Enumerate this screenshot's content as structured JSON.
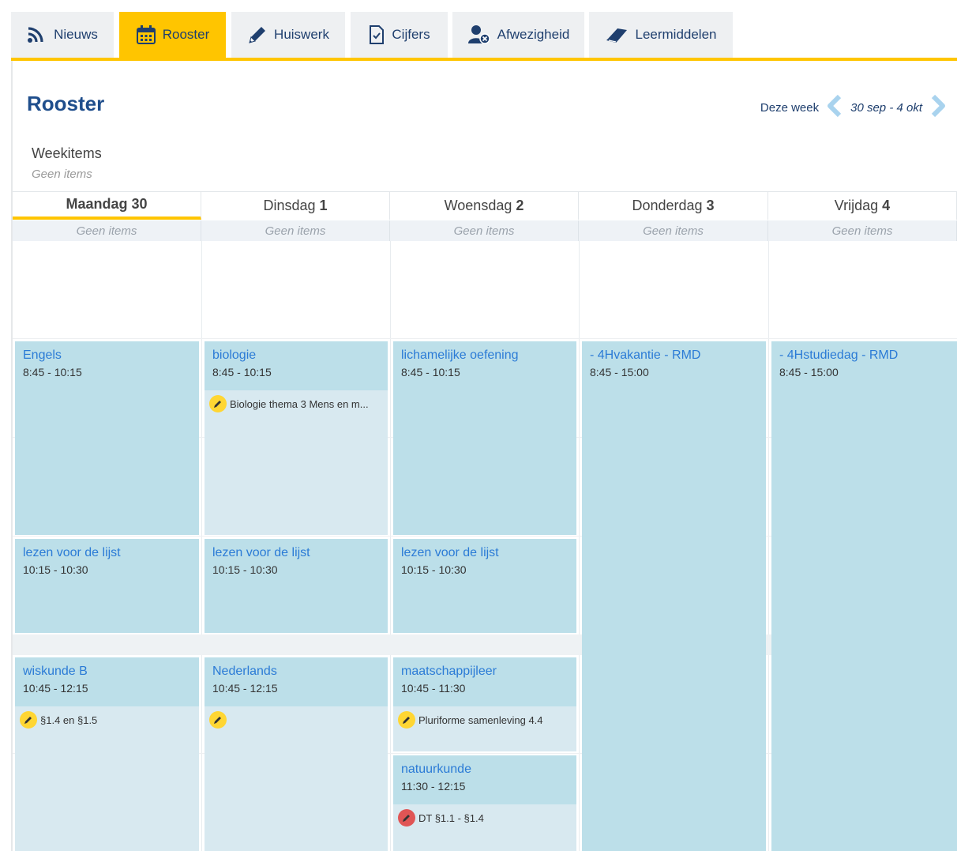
{
  "tabs": [
    {
      "label": "Nieuws",
      "icon": "rss-icon"
    },
    {
      "label": "Rooster",
      "icon": "calendar-icon"
    },
    {
      "label": "Huiswerk",
      "icon": "pencil-icon"
    },
    {
      "label": "Cijfers",
      "icon": "check-document-icon"
    },
    {
      "label": "Afwezigheid",
      "icon": "user-absent-icon"
    },
    {
      "label": "Leermiddelen",
      "icon": "book-icon"
    }
  ],
  "active_tab": "Rooster",
  "page": {
    "title": "Rooster",
    "week_label": "Deze week",
    "week_range": "30 sep - 4 okt",
    "weekitems_label": "Weekitems",
    "weekitems_empty": "Geen items"
  },
  "days": [
    {
      "name": "Maandag",
      "num": "30",
      "empty": "Geen items"
    },
    {
      "name": "Dinsdag",
      "num": "1",
      "empty": "Geen items"
    },
    {
      "name": "Woensdag",
      "num": "2",
      "empty": "Geen items"
    },
    {
      "name": "Donderdag",
      "num": "3",
      "empty": "Geen items"
    },
    {
      "name": "Vrijdag",
      "num": "4",
      "empty": "Geen items"
    }
  ],
  "lessons": {
    "mon": [
      {
        "subject": "Engels",
        "time": "8:45 - 10:15"
      },
      {
        "subject": "lezen voor de lijst",
        "time": "10:15 - 10:30"
      },
      {
        "subject": "wiskunde B",
        "time": "10:45 - 12:15",
        "homework": "§1.4 en §1.5"
      }
    ],
    "tue": [
      {
        "subject": "biologie",
        "time": "8:45 - 10:15",
        "homework": "Biologie thema 3 Mens en m..."
      },
      {
        "subject": "lezen voor de lijst",
        "time": "10:15 - 10:30"
      },
      {
        "subject": "Nederlands",
        "time": "10:45 - 12:15",
        "homework": ""
      }
    ],
    "wed": [
      {
        "subject": "lichamelijke oefening",
        "time": "8:45 - 10:15"
      },
      {
        "subject": "lezen voor de lijst",
        "time": "10:15 - 10:30"
      },
      {
        "subject": "maatschappijleer",
        "time": "10:45 - 11:30",
        "homework": "Pluriforme samenleving 4.4"
      },
      {
        "subject": "natuurkunde",
        "time": "11:30 - 12:15",
        "homework": "DT §1.1 - §1.4"
      }
    ],
    "thu": [
      {
        "subject": "- 4Hvakantie - RMD",
        "time": "8:45 - 15:00"
      }
    ],
    "fri": [
      {
        "subject": "- 4Hstudiedag - RMD",
        "time": "8:45 - 15:00"
      }
    ]
  },
  "colors": {
    "accent": "#ffc500",
    "title": "#1f4e8c",
    "lesson_bg": "#bcdfe9",
    "lesson_body": "#d8e9f0",
    "subject_link": "#2b7bd6",
    "homework_badge": "#ffd633",
    "test_badge": "#e05555"
  }
}
